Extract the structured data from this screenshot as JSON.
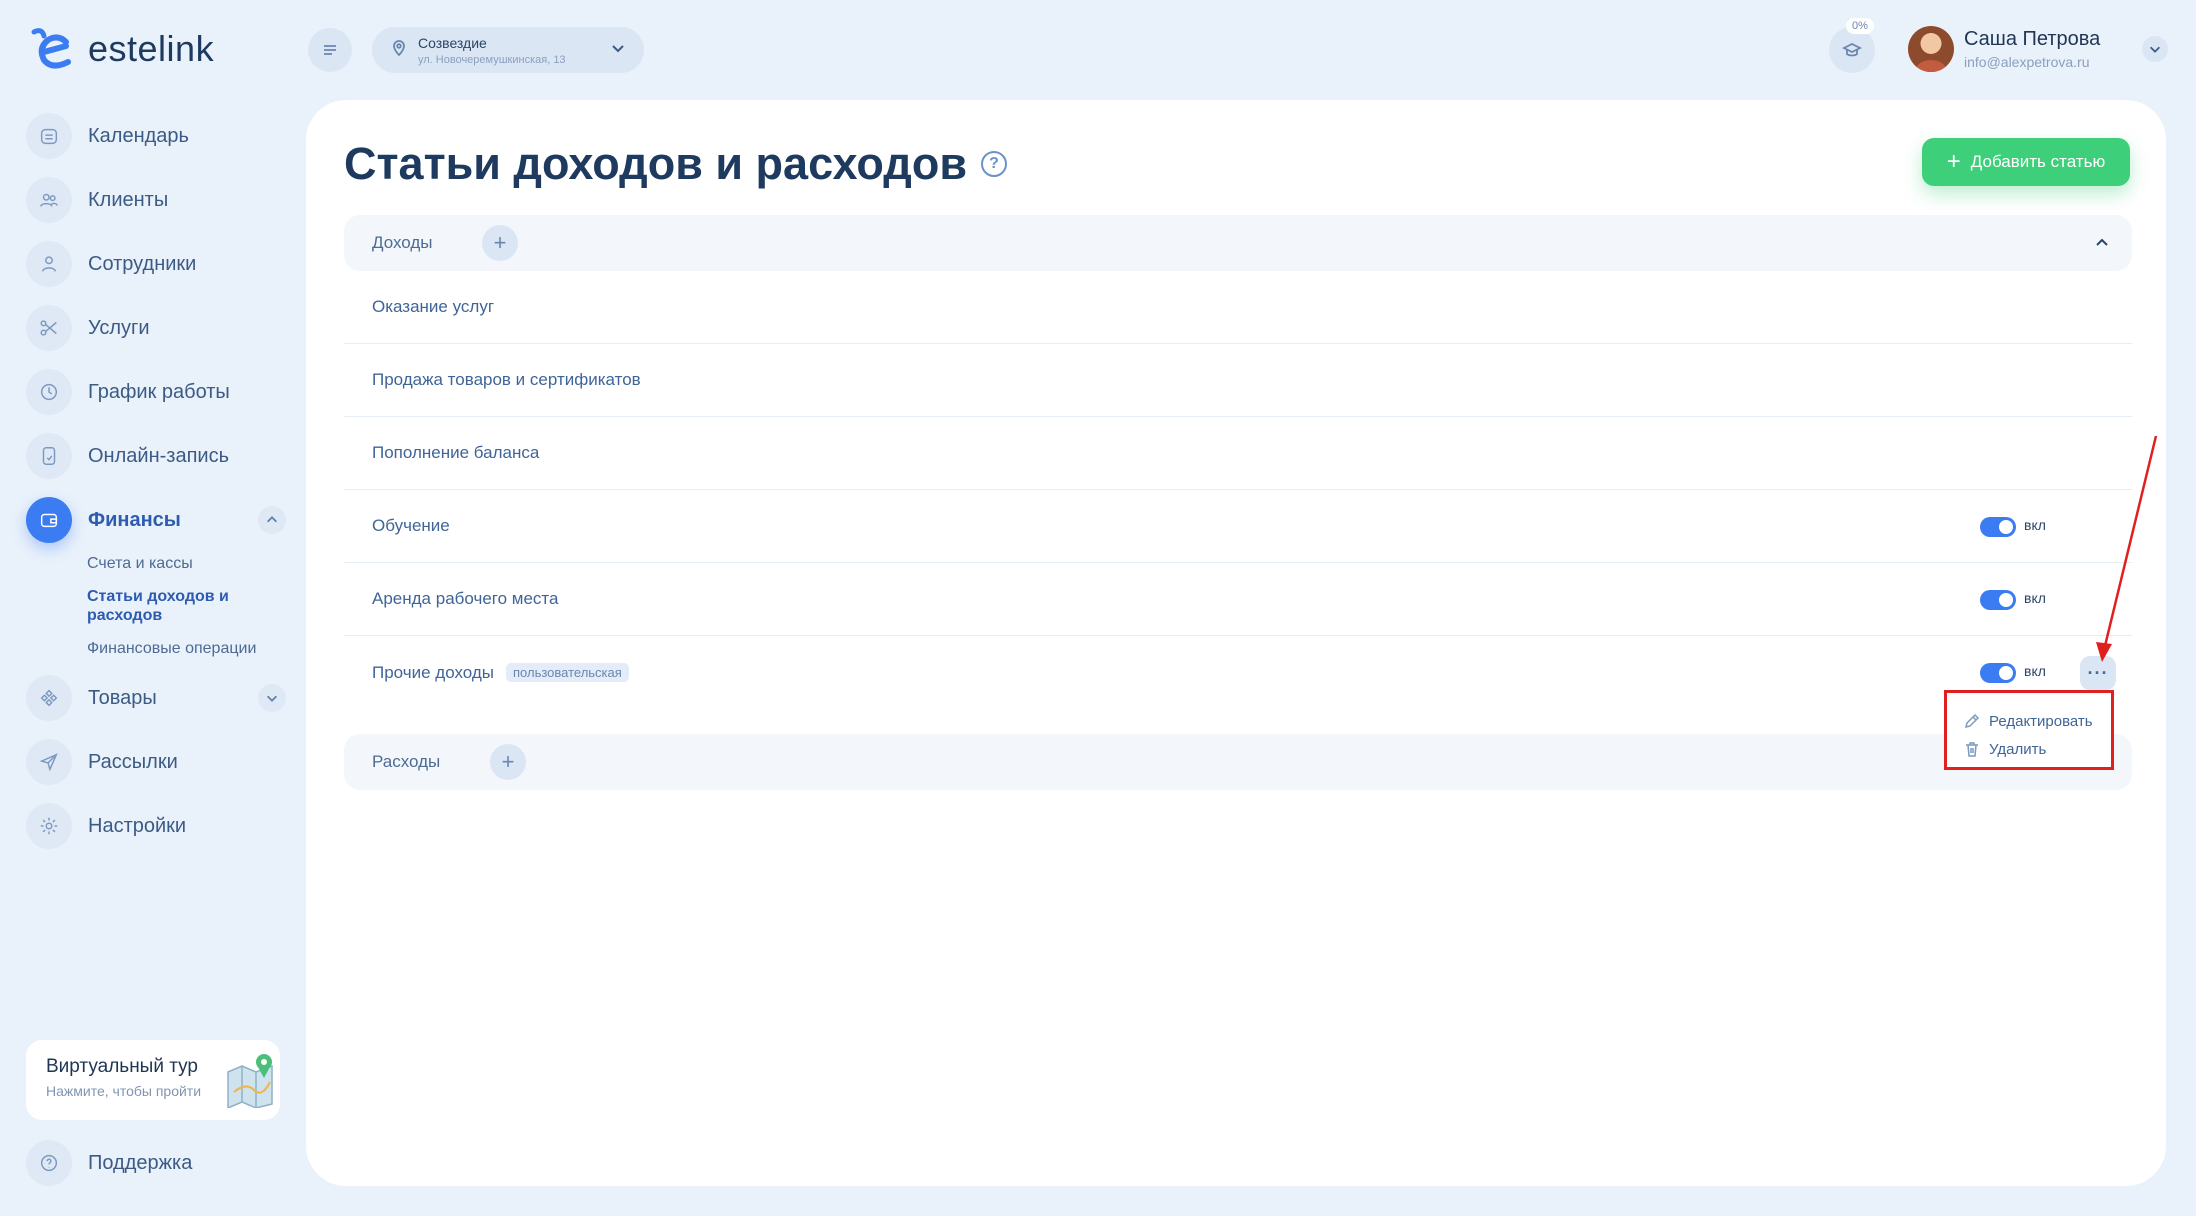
{
  "app": {
    "brand": "estelink"
  },
  "topbar": {
    "location_name": "Созвездие",
    "location_address": "ул. Новочеремушкинская, 13",
    "progress_badge": "0%",
    "user_name": "Саша Петрова",
    "user_email": "info@alexpetrova.ru"
  },
  "sidebar": {
    "items": [
      {
        "label": "Календарь",
        "icon": "calendar-icon"
      },
      {
        "label": "Клиенты",
        "icon": "clients-icon"
      },
      {
        "label": "Сотрудники",
        "icon": "employee-icon"
      },
      {
        "label": "Услуги",
        "icon": "scissors-icon"
      },
      {
        "label": "График работы",
        "icon": "clock-icon"
      },
      {
        "label": "Онлайн-запись",
        "icon": "phone-icon"
      },
      {
        "label": "Финансы",
        "icon": "wallet-icon",
        "active": true
      },
      {
        "label": "Товары",
        "icon": "products-icon"
      },
      {
        "label": "Рассылки",
        "icon": "send-icon"
      },
      {
        "label": "Настройки",
        "icon": "gear-icon"
      }
    ],
    "finance_sub": [
      {
        "label": "Счета и кассы"
      },
      {
        "label": "Статьи доходов и расходов",
        "active": true
      },
      {
        "label": "Финансовые операции"
      }
    ],
    "tour_title": "Виртуальный тур",
    "tour_subtitle": "Нажмите, чтобы пройти",
    "support_label": "Поддержка"
  },
  "main": {
    "title": "Статьи доходов и расходов",
    "add_button": "Добавить статью",
    "income": {
      "title": "Доходы",
      "rows": [
        {
          "label": "Оказание услуг"
        },
        {
          "label": "Продажа товаров и сертификатов"
        },
        {
          "label": "Пополнение баланса"
        },
        {
          "label": "Обучение",
          "toggle": "вкл"
        },
        {
          "label": "Аренда рабочего места",
          "toggle": "вкл"
        },
        {
          "label": "Прочие доходы",
          "tag": "пользовательская",
          "toggle": "вкл"
        }
      ]
    },
    "expenses": {
      "title": "Расходы"
    },
    "dropdown": {
      "edit": "Редактировать",
      "delete": "Удалить"
    }
  },
  "colors": {
    "accent": "#3b7cf2",
    "success": "#3ecf7a",
    "annotation": "#e0201e",
    "background": "#e9f1fb"
  }
}
